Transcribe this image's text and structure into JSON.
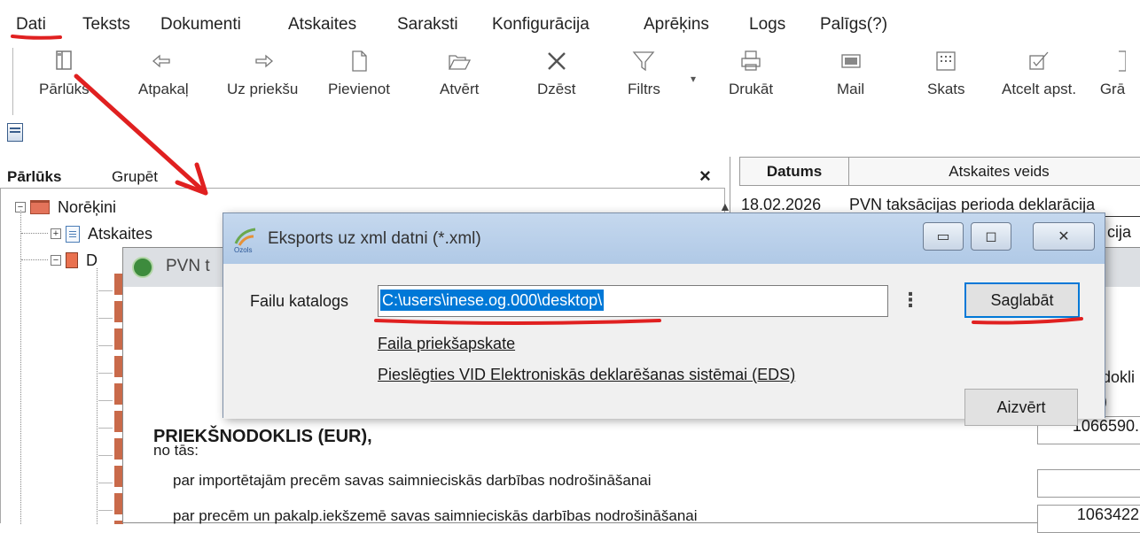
{
  "menu": [
    "Dati",
    "Teksts",
    "Dokumenti",
    "Atskaites",
    "Saraksti",
    "Konfigurācija",
    "Aprēķins",
    "Logs",
    "Palīgs(?)"
  ],
  "toolbar": {
    "parluks": "Pārlūks",
    "back": "Atpakaļ",
    "forward": "Uz priekšu",
    "add": "Pievienot",
    "open": "Atvērt",
    "delete": "Dzēst",
    "filter": "Filtrs",
    "print": "Drukāt",
    "mail": "Mail",
    "view": "Skats",
    "cancel_approve": "Atcelt apst.",
    "more": "Grā"
  },
  "panel": {
    "tab_browser": "Pārlūks",
    "tab_group": "Grupēt",
    "close": "×"
  },
  "tree": {
    "root": "Norēķini",
    "reports": "Atskaites",
    "docs_partial": "D"
  },
  "table": {
    "col_date": "Datums",
    "col_type": "Atskaites veids",
    "row1_date": "18.02.2026",
    "row1_type": "PVN taksācijas perioda deklarācija",
    "row2_type_partial": "cija"
  },
  "pvn_window": {
    "title": "PVN t",
    "heading": "PRIEKŠNODOKLIS (EUR),",
    "sub": "no tās:",
    "line1": "par importētajām precēm savas saimnieciskās darbības nodrošināšanai",
    "line2": "par precēm un pakalp.iekšzemē savas saimnieciskās darbības nodrošināšanai",
    "value_total": "1066590.",
    "value_line2": "1063422",
    "right_partial1": "dokli",
    "right_partial2": ")"
  },
  "dialog": {
    "title": "Eksports uz xml datni (*.xml)",
    "catalog_label": "Failu katalogs",
    "catalog_value": "C:\\users\\inese.og.000\\desktop\\",
    "save": "Saglabāt",
    "preview": "Faila priekšapskate",
    "connect": "Pieslēgties VID Elektroniskās deklarēšanas sistēmai (EDS)",
    "close": "Aizvērt"
  },
  "colors": {
    "annotation_red": "#e02020",
    "selection_blue": "#0078d7",
    "dialog_titlebar": "#b9cfe9"
  }
}
